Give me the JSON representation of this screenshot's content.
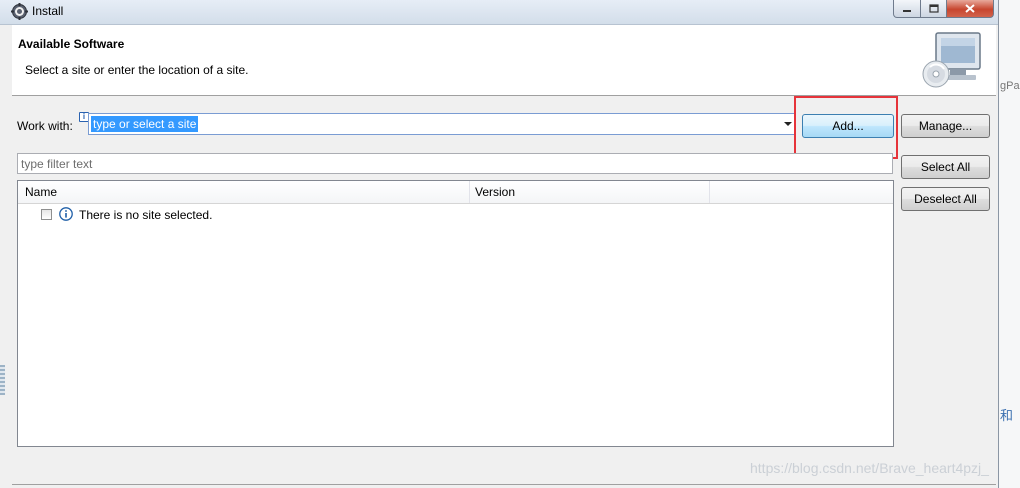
{
  "window": {
    "title": "Install",
    "title_icon": "eclipse-gear-icon"
  },
  "background": {
    "side_text": "gPa",
    "side_text2": "和"
  },
  "header": {
    "title": "Available Software",
    "subtitle": "Select a site or enter the location of a site.",
    "art_icon": "install-monitor-cd-icon"
  },
  "work_with": {
    "label": "Work with:",
    "value": "type or select a site"
  },
  "buttons": {
    "add": "Add...",
    "manage": "Manage...",
    "select_all": "Select All",
    "deselect_all": "Deselect All"
  },
  "filter": {
    "placeholder": "type filter text"
  },
  "table": {
    "columns": [
      "Name",
      "Version"
    ],
    "rows": [
      {
        "text": "There is no site selected.",
        "icon": "info-icon",
        "checked": false
      }
    ]
  },
  "watermark": "https://blog.csdn.net/Brave_heart4pzj_",
  "colors": {
    "highlight": "#e6333a",
    "selection": "#3399ff",
    "add_button_border": "#3c7fb1"
  }
}
